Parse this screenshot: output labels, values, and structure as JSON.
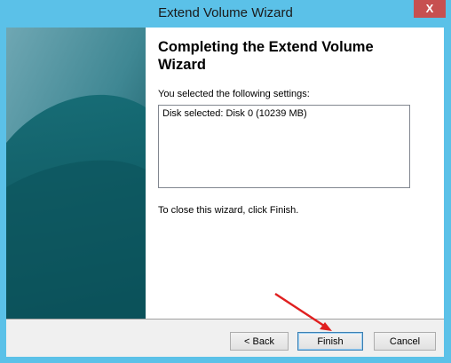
{
  "window": {
    "title": "Extend Volume Wizard",
    "close_glyph": "X"
  },
  "page": {
    "heading": "Completing the Extend Volume Wizard",
    "intro": "You selected the following settings:",
    "settings": "Disk selected: Disk 0 (10239 MB)",
    "closing": "To close this wizard, click Finish."
  },
  "buttons": {
    "back": "< Back",
    "finish": "Finish",
    "cancel": "Cancel"
  },
  "colors": {
    "accent": "#5bc1e8",
    "panel": "#0f5c63",
    "annotation_arrow": "#e02020"
  },
  "icons": {
    "annotation": "arrow-icon"
  }
}
